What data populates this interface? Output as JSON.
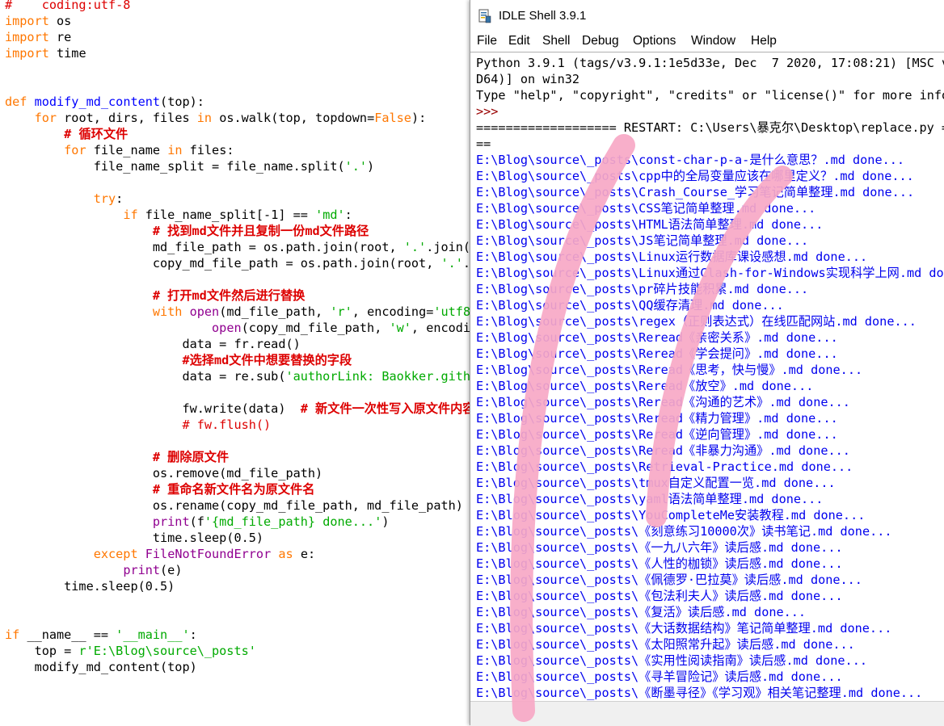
{
  "editor": {
    "lines": [
      {
        "segs": [
          {
            "t": "#    coding:utf-8",
            "c": "cm-plain"
          }
        ]
      },
      {
        "segs": [
          {
            "t": "import",
            "c": "kw"
          },
          {
            "t": " os"
          }
        ]
      },
      {
        "segs": [
          {
            "t": "import",
            "c": "kw"
          },
          {
            "t": " re"
          }
        ]
      },
      {
        "segs": [
          {
            "t": "import",
            "c": "kw"
          },
          {
            "t": " time"
          }
        ]
      },
      {
        "segs": [
          {
            "t": ""
          }
        ]
      },
      {
        "segs": [
          {
            "t": ""
          }
        ]
      },
      {
        "segs": [
          {
            "t": "def",
            "c": "kw"
          },
          {
            "t": " "
          },
          {
            "t": "modify_md_content",
            "c": "df"
          },
          {
            "t": "(top):"
          }
        ]
      },
      {
        "segs": [
          {
            "t": "    "
          },
          {
            "t": "for",
            "c": "kw"
          },
          {
            "t": " root, dirs, files "
          },
          {
            "t": "in",
            "c": "kw"
          },
          {
            "t": " os.walk(top, topdown="
          },
          {
            "t": "False",
            "c": "kw"
          },
          {
            "t": "):"
          }
        ]
      },
      {
        "segs": [
          {
            "t": "        "
          },
          {
            "t": "# 循环文件",
            "c": "cm"
          }
        ]
      },
      {
        "segs": [
          {
            "t": "        "
          },
          {
            "t": "for",
            "c": "kw"
          },
          {
            "t": " file_name "
          },
          {
            "t": "in",
            "c": "kw"
          },
          {
            "t": " files:"
          }
        ]
      },
      {
        "segs": [
          {
            "t": "            file_name_split = file_name.split("
          },
          {
            "t": "'.'",
            "c": "str"
          },
          {
            "t": ")"
          }
        ]
      },
      {
        "segs": [
          {
            "t": ""
          }
        ]
      },
      {
        "segs": [
          {
            "t": "            "
          },
          {
            "t": "try",
            "c": "kw"
          },
          {
            "t": ":"
          }
        ]
      },
      {
        "segs": [
          {
            "t": "                "
          },
          {
            "t": "if",
            "c": "kw"
          },
          {
            "t": " file_name_split[-1] == "
          },
          {
            "t": "'md'",
            "c": "str"
          },
          {
            "t": ":"
          }
        ]
      },
      {
        "segs": [
          {
            "t": "                    "
          },
          {
            "t": "# 找到md文件并且复制一份md文件路径",
            "c": "cm"
          }
        ]
      },
      {
        "segs": [
          {
            "t": "                    md_file_path = os.path.join(root, "
          },
          {
            "t": "'.'",
            "c": "str"
          },
          {
            "t": ".join(f"
          }
        ]
      },
      {
        "segs": [
          {
            "t": "                    copy_md_file_path = os.path.join(root, "
          },
          {
            "t": "'.'",
            "c": "str"
          },
          {
            "t": ".j"
          }
        ]
      },
      {
        "segs": [
          {
            "t": ""
          }
        ]
      },
      {
        "segs": [
          {
            "t": "                    "
          },
          {
            "t": "# 打开md文件然后进行替换",
            "c": "cm"
          }
        ]
      },
      {
        "segs": [
          {
            "t": "                    "
          },
          {
            "t": "with",
            "c": "kw"
          },
          {
            "t": " "
          },
          {
            "t": "open",
            "c": "bi"
          },
          {
            "t": "(md_file_path, "
          },
          {
            "t": "'r'",
            "c": "str"
          },
          {
            "t": ", encoding="
          },
          {
            "t": "'utf8'",
            "c": "str"
          }
        ]
      },
      {
        "segs": [
          {
            "t": "                            "
          },
          {
            "t": "open",
            "c": "bi"
          },
          {
            "t": "(copy_md_file_path, "
          },
          {
            "t": "'w'",
            "c": "str"
          },
          {
            "t": ", encodin"
          }
        ]
      },
      {
        "segs": [
          {
            "t": "                        data = fr.read()"
          }
        ]
      },
      {
        "segs": [
          {
            "t": "                        "
          },
          {
            "t": "#选择md文件中想要替换的字段",
            "c": "cm"
          }
        ]
      },
      {
        "segs": [
          {
            "t": "                        data = re.sub("
          },
          {
            "t": "'authorLink: Baokker.githu",
            "c": "str"
          }
        ]
      },
      {
        "segs": [
          {
            "t": ""
          }
        ]
      },
      {
        "segs": [
          {
            "t": "                        fw.write(data)  "
          },
          {
            "t": "# 新文件一次性写入原文件内容",
            "c": "cm"
          }
        ]
      },
      {
        "segs": [
          {
            "t": "                        "
          },
          {
            "t": "# fw.flush()",
            "c": "cmr"
          }
        ]
      },
      {
        "segs": [
          {
            "t": ""
          }
        ]
      },
      {
        "segs": [
          {
            "t": "                    "
          },
          {
            "t": "# 删除原文件",
            "c": "cm"
          }
        ]
      },
      {
        "segs": [
          {
            "t": "                    os.remove(md_file_path)"
          }
        ]
      },
      {
        "segs": [
          {
            "t": "                    "
          },
          {
            "t": "# 重命名新文件名为原文件名",
            "c": "cm"
          }
        ]
      },
      {
        "segs": [
          {
            "t": "                    os.rename(copy_md_file_path, md_file_path)"
          }
        ]
      },
      {
        "segs": [
          {
            "t": "                    "
          },
          {
            "t": "print",
            "c": "bi"
          },
          {
            "t": "(f"
          },
          {
            "t": "'{md_file_path} done...'",
            "c": "str"
          },
          {
            "t": ")"
          }
        ]
      },
      {
        "segs": [
          {
            "t": "                    time.sleep(0.5)"
          }
        ]
      },
      {
        "segs": [
          {
            "t": "            "
          },
          {
            "t": "except",
            "c": "kw"
          },
          {
            "t": " "
          },
          {
            "t": "FileNotFoundError",
            "c": "bi"
          },
          {
            "t": " "
          },
          {
            "t": "as",
            "c": "kw"
          },
          {
            "t": " e:"
          }
        ]
      },
      {
        "segs": [
          {
            "t": "                "
          },
          {
            "t": "print",
            "c": "bi"
          },
          {
            "t": "(e)"
          }
        ]
      },
      {
        "segs": [
          {
            "t": "        time.sleep(0.5)"
          }
        ]
      },
      {
        "segs": [
          {
            "t": ""
          }
        ]
      },
      {
        "segs": [
          {
            "t": ""
          }
        ]
      },
      {
        "segs": [
          {
            "t": "if",
            "c": "kw"
          },
          {
            "t": " __name__ == "
          },
          {
            "t": "'__main__'",
            "c": "str"
          },
          {
            "t": ":"
          }
        ]
      },
      {
        "segs": [
          {
            "t": "    top = "
          },
          {
            "t": "r'E:\\Blog\\source\\_posts'",
            "c": "str"
          }
        ]
      },
      {
        "segs": [
          {
            "t": "    modify_md_content(top)"
          }
        ]
      }
    ]
  },
  "shell": {
    "title": "IDLE Shell 3.9.1",
    "menu": [
      "File",
      "Edit",
      "Shell",
      "Debug",
      "Options",
      "Window",
      "Help"
    ],
    "header": [
      "Python 3.9.1 (tags/v3.9.1:1e5d33e, Dec  7 2020, 17:08:21) [MSC v.",
      "D64)] on win32",
      "Type \"help\", \"copyright\", \"credits\" or \"license()\" for more infor"
    ],
    "prompt": ">>>",
    "restart": [
      "=================== RESTART: C:\\Users\\暴克尔\\Desktop\\replace.py ==",
      "=="
    ],
    "output": [
      "E:\\Blog\\source\\_posts\\const-char-p-a-是什么意思？.md done...",
      "E:\\Blog\\source\\_posts\\cpp中的全局变量应该在哪里定义？.md done...",
      "E:\\Blog\\source\\_posts\\Crash_Course_学习笔记简单整理.md done...",
      "E:\\Blog\\source\\_posts\\CSS笔记简单整理.md done...",
      "E:\\Blog\\source\\_posts\\HTML语法简单整理.md done...",
      "E:\\Blog\\source\\_posts\\JS笔记简单整理.md done...",
      "E:\\Blog\\source\\_posts\\Linux运行数据库课设感想.md done...",
      "E:\\Blog\\source\\_posts\\Linux通过Clash-for-Windows实现科学上网.md done",
      "E:\\Blog\\source\\_posts\\pr碎片技能积累.md done...",
      "E:\\Blog\\source\\_posts\\QQ缓存清理.md done...",
      "E:\\Blog\\source\\_posts\\regex（正则表达式）在线匹配网站.md done...",
      "E:\\Blog\\source\\_posts\\Reread《亲密关系》.md done...",
      "E:\\Blog\\source\\_posts\\Reread《学会提问》.md done...",
      "E:\\Blog\\source\\_posts\\Reread《思考，快与慢》.md done...",
      "E:\\Blog\\source\\_posts\\Reread《放空》.md done...",
      "E:\\Blog\\source\\_posts\\Reread《沟通的艺术》.md done...",
      "E:\\Blog\\source\\_posts\\Reread《精力管理》.md done...",
      "E:\\Blog\\source\\_posts\\Reread《逆向管理》.md done...",
      "E:\\Blog\\source\\_posts\\Reread《非暴力沟通》.md done...",
      "E:\\Blog\\source\\_posts\\Retrieval-Practice.md done...",
      "E:\\Blog\\source\\_posts\\tmux自定义配置一览.md done...",
      "E:\\Blog\\source\\_posts\\yaml语法简单整理.md done...",
      "E:\\Blog\\source\\_posts\\YouCompleteMe安装教程.md done...",
      "E:\\Blog\\source\\_posts\\《刻意练习10000次》读书笔记.md done...",
      "E:\\Blog\\source\\_posts\\《一九八六年》读后感.md done...",
      "E:\\Blog\\source\\_posts\\《人性的枷锁》读后感.md done...",
      "E:\\Blog\\source\\_posts\\《佩德罗·巴拉莫》读后感.md done...",
      "E:\\Blog\\source\\_posts\\《包法利夫人》读后感.md done...",
      "E:\\Blog\\source\\_posts\\《复活》读后感.md done...",
      "E:\\Blog\\source\\_posts\\《大话数据结构》笔记简单整理.md done...",
      "E:\\Blog\\source\\_posts\\《太阳照常升起》读后感.md done...",
      "E:\\Blog\\source\\_posts\\《实用性阅读指南》读后感.md done...",
      "E:\\Blog\\source\\_posts\\《寻羊冒险记》读后感.md done...",
      "E:\\Blog\\source\\_posts\\《断墨寻径》《学习观》相关笔记整理.md done..."
    ]
  },
  "colors": {
    "keyword": "#ff7700",
    "string": "#00aa00",
    "builtin": "#900090",
    "def": "#0000ff",
    "comment": "#dd0000",
    "output": "#0000ee",
    "scribble": "#f7a8c6"
  }
}
